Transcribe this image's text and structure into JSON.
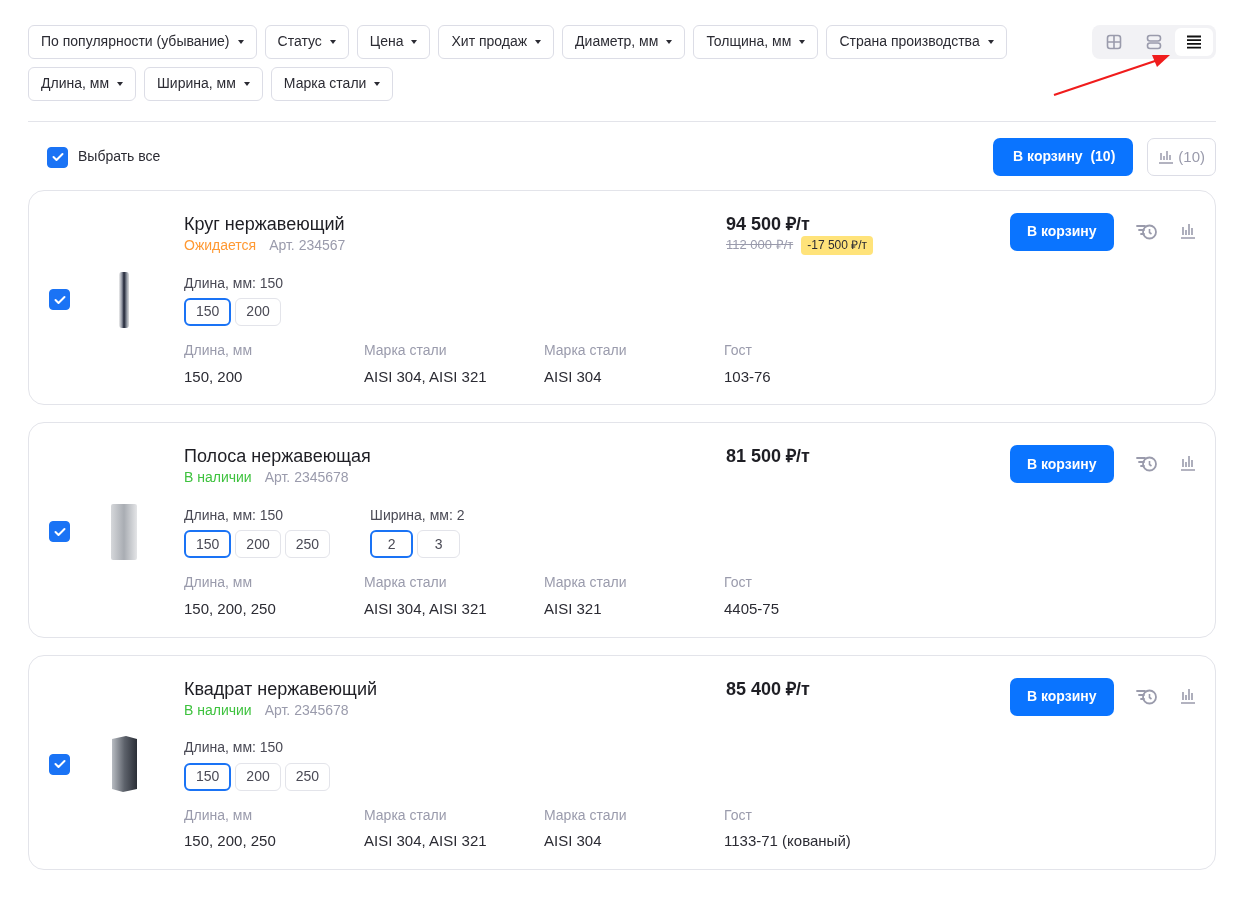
{
  "filters": [
    {
      "label": "По популярности (убывание)"
    },
    {
      "label": "Статус"
    },
    {
      "label": "Цена"
    },
    {
      "label": "Хит продаж"
    },
    {
      "label": "Диаметр, мм"
    },
    {
      "label": "Толщина, мм"
    },
    {
      "label": "Страна производства"
    },
    {
      "label": "Длина, мм"
    },
    {
      "label": "Ширина, мм"
    },
    {
      "label": "Марка стали"
    }
  ],
  "view_modes": [
    {
      "kind": "grid",
      "selected": false
    },
    {
      "kind": "rows",
      "selected": false
    },
    {
      "kind": "list",
      "selected": true
    }
  ],
  "annotation": {
    "kind": "arrow"
  },
  "select_all": {
    "label": "Выбрать все",
    "checked": true
  },
  "cart_button": {
    "label": "В корзину",
    "count": "(10)"
  },
  "compare_button": {
    "count": "(10)"
  },
  "products": [
    {
      "name": "Круг нержавеющий",
      "checked": true,
      "status": {
        "text": "Ожидается",
        "kind": "awaiting"
      },
      "article": "Арт. 234567",
      "price": "94 500 ₽/т",
      "old_price": "112 000 ₽/т",
      "discount": "-17 500 ₽/т",
      "button": "В корзину",
      "option_groups": [
        {
          "label": "Длина, мм: 150",
          "options": [
            {
              "value": "150",
              "selected": true
            },
            {
              "value": "200",
              "selected": false
            }
          ]
        }
      ],
      "specs": [
        {
          "label": "Длина, мм",
          "value": "150, 200"
        },
        {
          "label": "Марка стали",
          "value": "AISI 304, AISI 321"
        },
        {
          "label": "Марка стали",
          "value": "AISI 304"
        },
        {
          "label": "Гост",
          "value": "103-76"
        }
      ]
    },
    {
      "name": "Полоса нержавеющая",
      "checked": true,
      "status": {
        "text": "В наличии",
        "kind": "in_stock"
      },
      "article": "Арт. 2345678",
      "price": "81 500 ₽/т",
      "button": "В корзину",
      "option_groups": [
        {
          "label": "Длина, мм: 150",
          "options": [
            {
              "value": "150",
              "selected": true
            },
            {
              "value": "200",
              "selected": false
            },
            {
              "value": "250",
              "selected": false
            }
          ]
        },
        {
          "label": "Ширина, мм: 2",
          "options": [
            {
              "value": "2",
              "selected": true
            },
            {
              "value": "3",
              "selected": false
            }
          ]
        }
      ],
      "specs": [
        {
          "label": "Длина, мм",
          "value": "150, 200, 250"
        },
        {
          "label": "Марка стали",
          "value": "AISI 304, AISI 321"
        },
        {
          "label": "Марка стали",
          "value": "AISI 321"
        },
        {
          "label": "Гост",
          "value": "4405-75"
        }
      ]
    },
    {
      "name": "Квадрат нержавеющий",
      "checked": true,
      "status": {
        "text": "В наличии",
        "kind": "in_stock"
      },
      "article": "Арт. 2345678",
      "price": "85 400 ₽/т",
      "button": "В корзину",
      "option_groups": [
        {
          "label": "Длина, мм: 150",
          "options": [
            {
              "value": "150",
              "selected": true
            },
            {
              "value": "200",
              "selected": false
            },
            {
              "value": "250",
              "selected": false
            }
          ]
        }
      ],
      "specs": [
        {
          "label": "Длина, мм",
          "value": "150, 200, 250"
        },
        {
          "label": "Марка стали",
          "value": "AISI 304, AISI 321"
        },
        {
          "label": "Марка стали",
          "value": "AISI 304"
        },
        {
          "label": "Гост",
          "value": "1133-71 (кованый)"
        }
      ]
    }
  ]
}
